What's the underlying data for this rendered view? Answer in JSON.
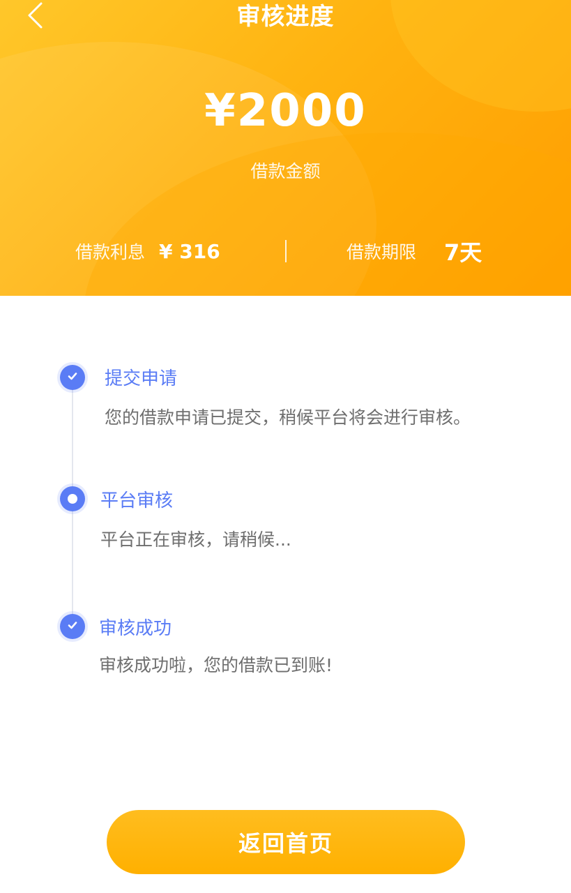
{
  "header": {
    "title": "审核进度",
    "back_icon": "chevron-left-icon",
    "amount": "¥2000",
    "amount_label": "借款金额",
    "interest_label": "借款利息",
    "interest_value": "¥ 316",
    "term_label": "借款期限",
    "term_value": "7天",
    "gradient_colors": [
      "#ffc72a",
      "#ffb310",
      "#ff9d00"
    ]
  },
  "timeline": {
    "accent_color": "#5a7cf5",
    "steps": [
      {
        "title": "提交申请",
        "desc": "您的借款申请已提交，稍候平台将会进行审核。",
        "state": "done",
        "icon": "check-icon"
      },
      {
        "title": "平台审核",
        "desc": "平台正在审核，请稍候...",
        "state": "active",
        "icon": "dot-icon"
      },
      {
        "title": "审核成功",
        "desc": "审核成功啦，您的借款已到账!",
        "state": "done",
        "icon": "check-icon"
      }
    ]
  },
  "footer": {
    "home_button_label": "返回首页"
  }
}
